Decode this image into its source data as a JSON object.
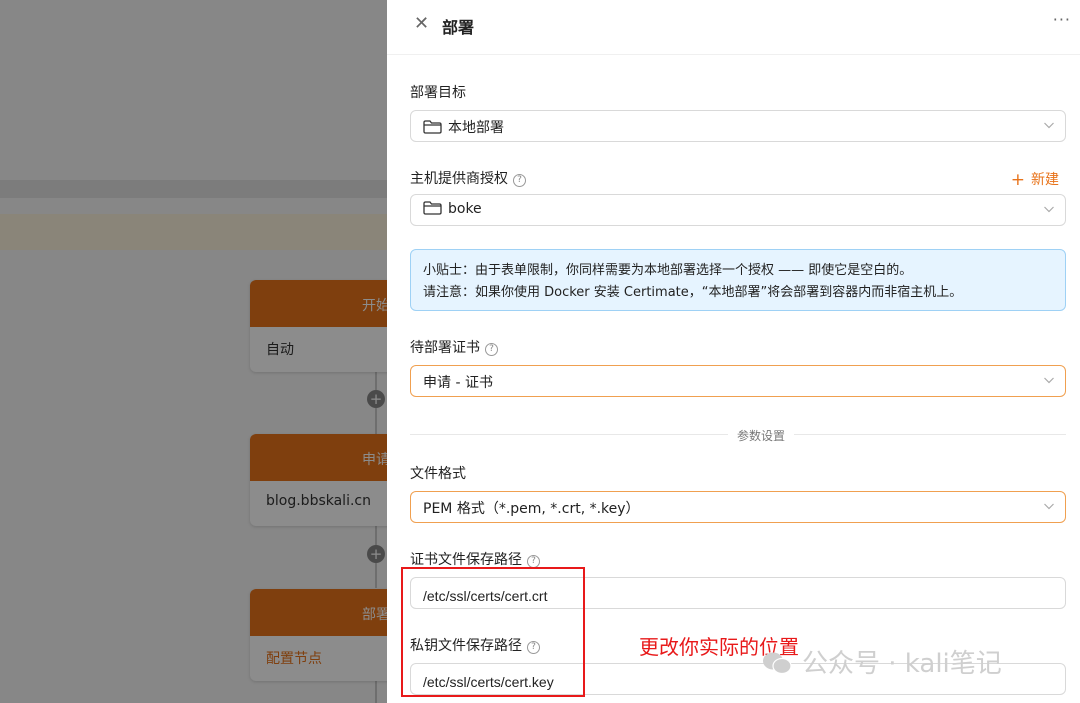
{
  "background": {
    "nodes": [
      {
        "head": "开始",
        "body": "自动"
      },
      {
        "head": "申请",
        "body": "blog.bbskali.cn"
      },
      {
        "head": "部署",
        "body": "配置节点"
      }
    ]
  },
  "drawer": {
    "title": "部署",
    "more": "···",
    "deploy_target": {
      "label": "部署目标",
      "value": "本地部署"
    },
    "provider_auth": {
      "label": "主机提供商授权",
      "value": "boke",
      "new_label": "新建"
    },
    "tip": {
      "line1": "小贴士：由于表单限制，你同样需要为本地部署选择一个授权 —— 即使它是空白的。",
      "line2": "请注意：如果你使用 Docker 安装 Certimate，“本地部署”将会部署到容器内而非宿主机上。"
    },
    "cert": {
      "label": "待部署证书",
      "value": "申请 - 证书"
    },
    "divider": "参数设置",
    "file_format": {
      "label": "文件格式",
      "value": "PEM 格式（*.pem, *.crt, *.key）"
    },
    "cert_path": {
      "label": "证书文件保存路径",
      "value": "/etc/ssl/certs/cert.crt"
    },
    "key_path": {
      "label": "私钥文件保存路径",
      "value": "/etc/ssl/certs/cert.key"
    }
  },
  "annotation": "更改你实际的位置",
  "watermark": "公众号 · kali笔记",
  "colors": {
    "accent": "#e8731a",
    "annotation_red": "#e8191a",
    "tip_bg": "#e6f4ff",
    "tip_border": "#9ed1f5"
  }
}
